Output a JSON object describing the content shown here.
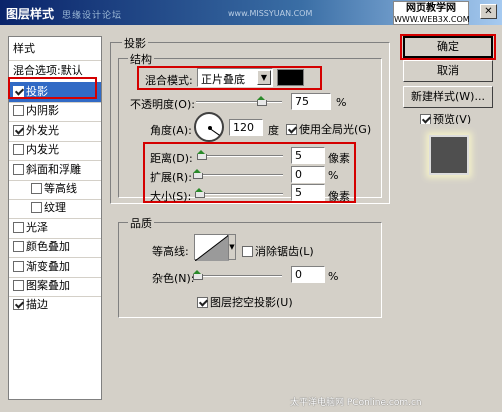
{
  "window": {
    "title": "图层样式",
    "watermark_left": "思缘设计论坛",
    "watermark_url": "www.MISSYUAN.COM",
    "brand_top": "网页教学网",
    "brand_bottom": "WWW.WEB3X.COM",
    "close_glyph": "✕",
    "footer_watermark": "太平洋电脑网 PConline.com.cn"
  },
  "sidebar": {
    "header": "样式",
    "blend_options": "混合选项:默认",
    "items": [
      {
        "label": "投影",
        "checked": true,
        "selected": true
      },
      {
        "label": "内阴影",
        "checked": false
      },
      {
        "label": "外发光",
        "checked": true
      },
      {
        "label": "内发光",
        "checked": false
      },
      {
        "label": "斜面和浮雕",
        "checked": false
      },
      {
        "label": "等高线",
        "checked": false,
        "indent": true
      },
      {
        "label": "纹理",
        "checked": false,
        "indent": true
      },
      {
        "label": "光泽",
        "checked": false
      },
      {
        "label": "颜色叠加",
        "checked": false
      },
      {
        "label": "渐变叠加",
        "checked": false
      },
      {
        "label": "图案叠加",
        "checked": false
      },
      {
        "label": "描边",
        "checked": true
      }
    ]
  },
  "drop_shadow": {
    "group_title": "投影",
    "structure_title": "结构",
    "blend_mode_label": "混合模式:",
    "blend_mode_value": "正片叠底",
    "color": "#000000",
    "opacity_label": "不透明度(O):",
    "opacity_value": "75",
    "opacity_unit": "%",
    "opacity_level": 0.75,
    "angle_label": "角度(A):",
    "angle_value": "120",
    "angle_unit": "度",
    "global_light_label": "使用全局光(G)",
    "global_light_checked": true,
    "distance_label": "距离(D):",
    "distance_value": "5",
    "distance_unit": "像素",
    "spread_label": "扩展(R):",
    "spread_value": "0",
    "spread_unit": "%",
    "size_label": "大小(S):",
    "size_value": "5",
    "size_unit": "像素"
  },
  "quality": {
    "title": "品质",
    "contour_label": "等高线:",
    "anti_alias_label": "消除锯齿(L)",
    "anti_alias_checked": false,
    "noise_label": "杂色(N):",
    "noise_value": "0",
    "noise_unit": "%",
    "knockout_label": "图层挖空投影(U)",
    "knockout_checked": true
  },
  "buttons": {
    "ok": "确定",
    "cancel": "取消",
    "new_style": "新建样式(W)...",
    "preview_label": "预览(V)",
    "preview_checked": true
  },
  "colors": {
    "highlight": "#316ac5",
    "annotation_red": "#d40000"
  }
}
